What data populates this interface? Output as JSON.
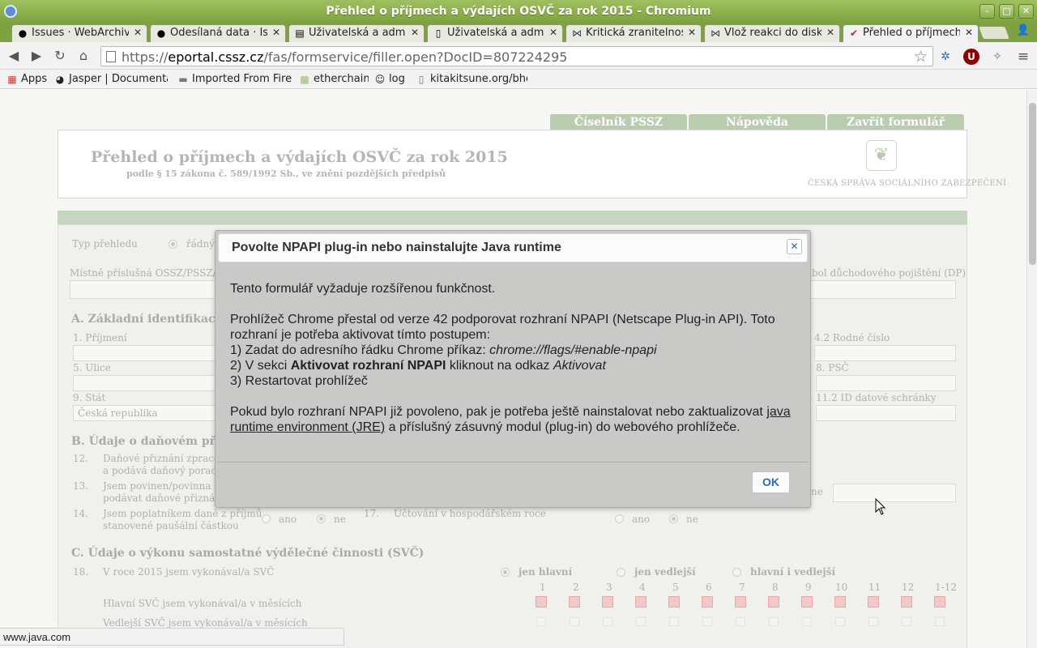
{
  "window": {
    "title": "Přehled o příjmech a výdajích OSVČ za rok 2015 - Chromium",
    "buttons": [
      "minimize",
      "maximize",
      "close"
    ]
  },
  "tabs": [
    {
      "label": "Issues · WebArchivCz",
      "icon": "github-icon"
    },
    {
      "label": "Odesílaná data · Issue",
      "icon": "github-icon"
    },
    {
      "label": "Uživatelská a admini",
      "icon": "book-icon"
    },
    {
      "label": "Uživatelská a admini",
      "icon": "page-icon"
    },
    {
      "label": "Kritická zranitelnost",
      "icon": "site-icon"
    },
    {
      "label": "Vlož reakci do diskus",
      "icon": "site-icon"
    },
    {
      "label": "Přehled o příjmech a",
      "icon": "cssz-icon",
      "active": true
    }
  ],
  "toolbar": {
    "url_prefix": "https://",
    "url_host": "eportal.cssz.cz",
    "url_path": "/fas/formservice/filler.open?DocID=807224295"
  },
  "bookmarks": [
    {
      "label": "Apps",
      "icon": "apps-grid-icon"
    },
    {
      "label": "Jasper | Documentat",
      "icon": "jasper-icon"
    },
    {
      "label": "Imported From Firefo",
      "icon": "folder-icon"
    },
    {
      "label": "etherchain",
      "icon": "etherchain-icon"
    },
    {
      "label": "log",
      "icon": "reddit-icon"
    },
    {
      "label": "kitakitsune.org/bhole",
      "icon": "page-icon"
    }
  ],
  "page": {
    "nav": [
      "Číselník PSSZ",
      "Nápověda",
      "Zavřít formulář"
    ],
    "header_title": "Přehled o příjmech a výdajích OSVČ za rok 2015",
    "header_subtitle": "podle § 15 zákona č. 589/1992 Sb., ve znění pozdějších předpisů",
    "logo_text": "ČESKÁ SPRÁVA SOCIÁLNÍHO ZABEZPEČENÍ",
    "form": {
      "typ_prehledu": "Typ přehledu",
      "radny": "řádný",
      "mistne": "Místně příslušná OSSZ/PSSZ/MSSZ",
      "symbol_dp": "bol důchodového pojištění (DP)",
      "sectionA": "A. Základní identifikace",
      "prijmeni": "1. Příjmení",
      "rodne_cislo": "4.2 Rodné číslo",
      "ulice": "5. Ulice",
      "psc": "8. PSČ",
      "stat": "9. Stát",
      "stat_value": "Česká republika",
      "id_schranky": "11.2 ID datové schránky",
      "sectionB": "B. Údaje o daňovém přiznán",
      "q12a": "Daňové přiznání zpracovává",
      "q12b": "a podává daňový poradce",
      "q12n": "12.",
      "q13a": "Jsem povinen/povinna",
      "q13b": "podávat daňové přiznání",
      "q13n": "13.",
      "q14a": "Jsem poplatníkem daně z příjmů",
      "q14b": "stanovené paušální částkou",
      "q14n": "14.",
      "q17n": "17.",
      "q17": "Účtování v hospodářském roce",
      "ne_suffix": "ne",
      "ano": "ano",
      "ne": "ne",
      "sectionC": "C. Údaje o výkonu samostatné výdělečné činnosti (SVČ)",
      "q18n": "18.",
      "q18": "V roce 2015 jsem vykonával/a SVČ",
      "jen_hlavni": "jen hlavní",
      "jen_vedlejsi": "jen vedlejší",
      "hlavni_i_vedlejsi": "hlavní i vedlejší",
      "months": [
        "1",
        "2",
        "3",
        "4",
        "5",
        "6",
        "7",
        "8",
        "9",
        "10",
        "11",
        "12",
        "1-12"
      ],
      "hlavni_mesice": "Hlavní SVČ jsem vykonával/a v měsících",
      "vedlejsi_mesice": "Vedlejší SVČ jsem vykonával/a v měsících"
    }
  },
  "modal": {
    "title": "Povolte NPAPI plug-in nebo nainstalujte Java runtime",
    "p1": "Tento formulář vyžaduje rozšířenou funkčnost.",
    "p2_intro": "Prohlížeč Chrome přestal od verze 42 podporovat rozhraní NPAPI (Netscape Plug-in API). Toto rozhraní je potřeba aktivovat tímto postupem:",
    "step1_prefix": "1) Zadat do adresního řádku Chrome příkaz: ",
    "step1_cmd": "chrome://flags/#enable-npapi",
    "step2_prefix": "2) V sekci ",
    "step2_bold": "Aktivovat rozhraní NPAPI",
    "step2_mid": " kliknout na odkaz ",
    "step2_italic": "Aktivovat",
    "step3": "3) Restartovat prohlížeč",
    "p3_prefix": "Pokud bylo rozhraní NPAPI již povoleno, pak je potřeba ještě nainstalovat nebo zaktualizovat ",
    "p3_link": "java runtime environment (JRE)",
    "p3_suffix": " a příslušný zásuvný modul (plug-in) do webového prohlížeče.",
    "close_glyph": "✕",
    "ok_label": "OK"
  },
  "statusbar": {
    "text": "www.java.com"
  }
}
